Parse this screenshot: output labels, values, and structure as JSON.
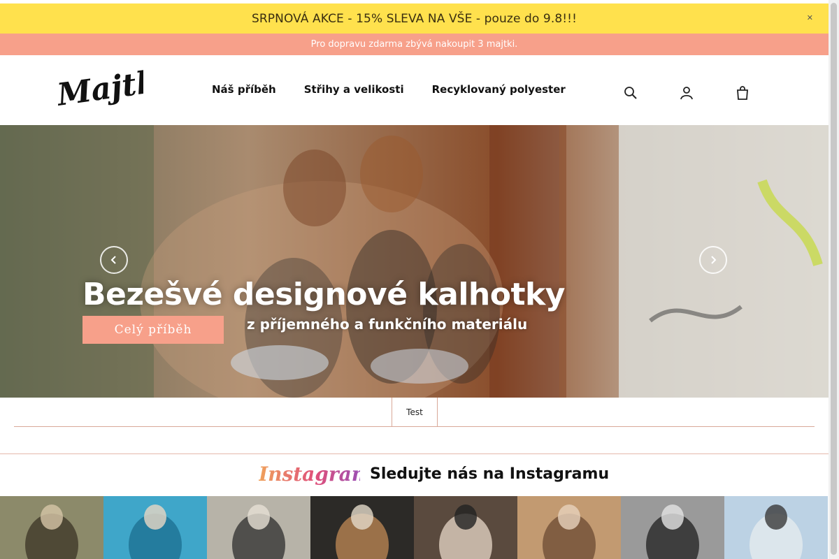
{
  "promo": {
    "text": "SRPNOVÁ AKCE - 15% SLEVA NA VŠE - pouze do 9.8!!!",
    "close_icon": "close-icon"
  },
  "shipping": {
    "text": "Pro dopravu zdarma zbývá nakoupit 3 majtki."
  },
  "header": {
    "logo": "Majtki",
    "nav": [
      {
        "label": "Náš příběh"
      },
      {
        "label": "Střihy a velikosti"
      },
      {
        "label": "Recyklovaný polyester"
      }
    ],
    "icons": [
      "search-icon",
      "user-icon",
      "cart-icon"
    ]
  },
  "hero": {
    "title": "Bezešvé designové kalhotky",
    "subtitle": "z příjemného a funkčního materiálu",
    "button": "Celý příběh",
    "prev_icon": "chevron-left-icon",
    "next_icon": "chevron-right-icon"
  },
  "tabs": [
    {
      "label": "Test"
    }
  ],
  "instagram": {
    "logo_text": "Instagram",
    "title": "Sledujte nás na Instagramu",
    "post_count": 8
  },
  "colors": {
    "promo_bg": "#ffe14d",
    "accent": "#f7a08a",
    "divider": "#d9a898"
  }
}
